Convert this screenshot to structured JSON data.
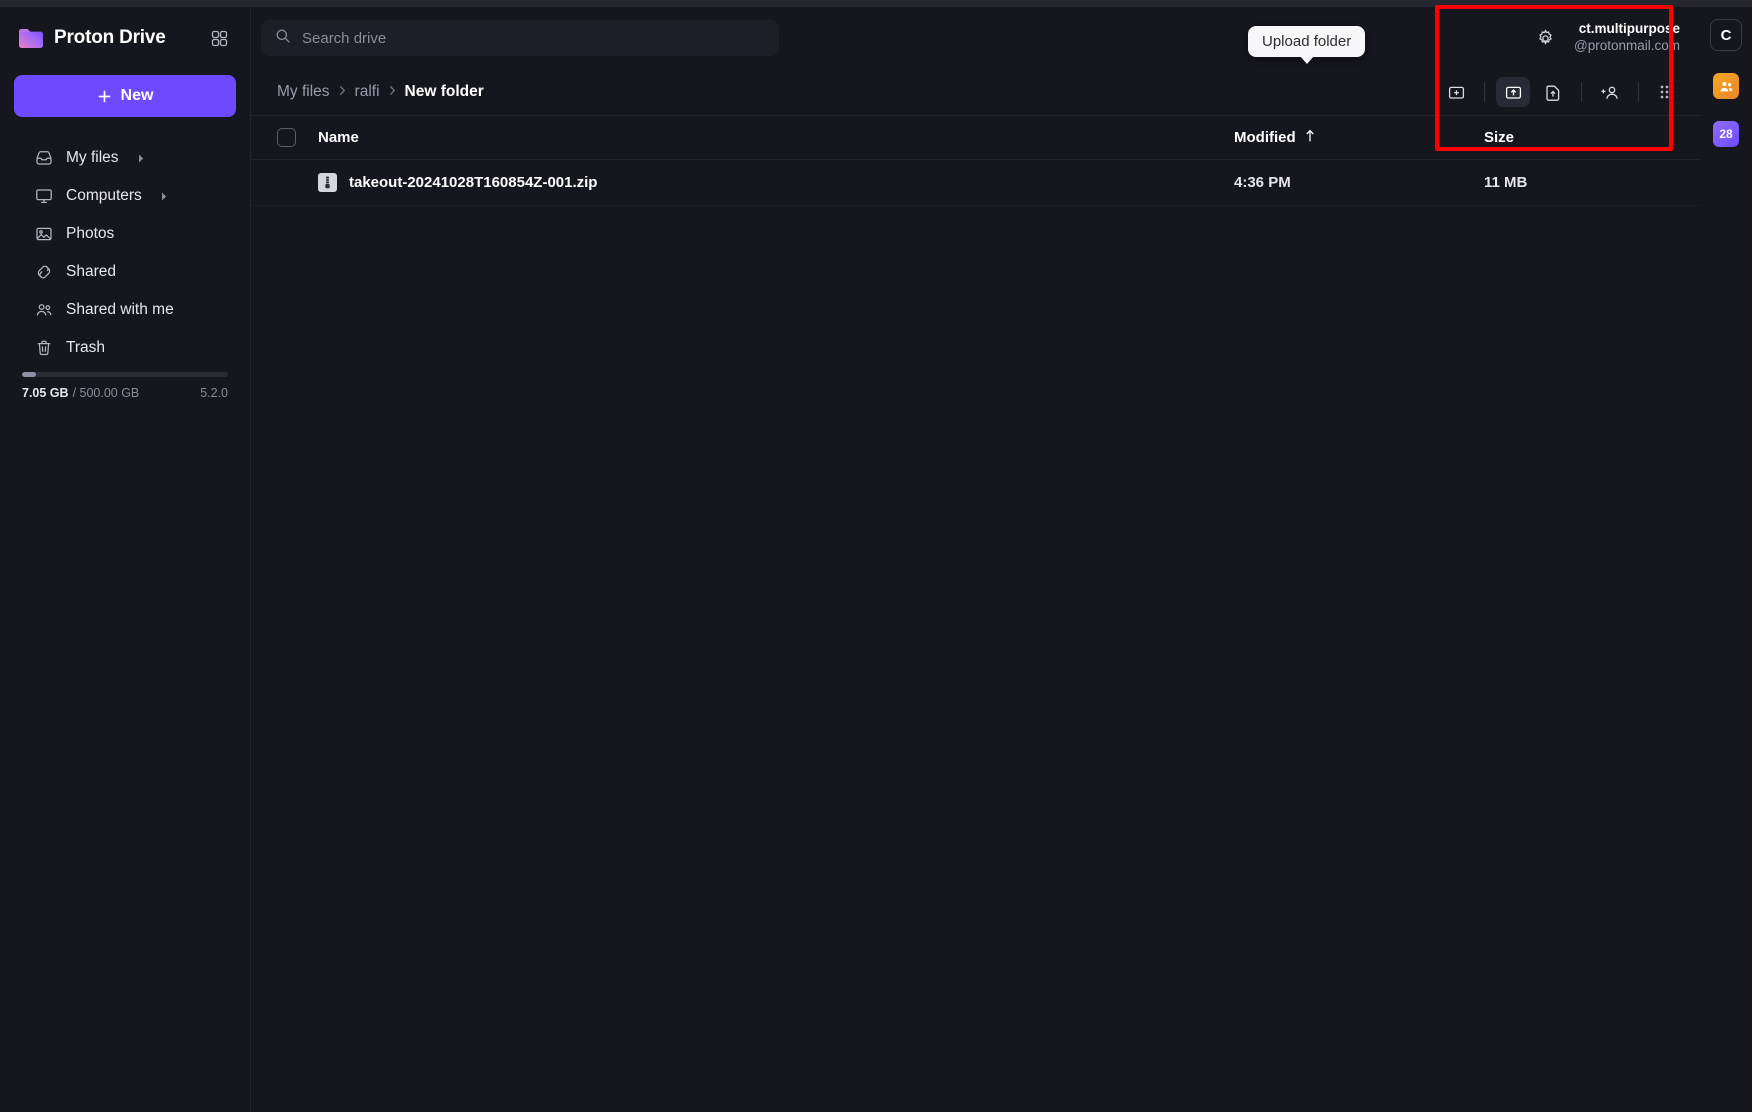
{
  "app": {
    "brand": "Proton Drive",
    "version": "5.2.0"
  },
  "sidebar": {
    "new_button": "New",
    "apps_grid_icon": "apps-grid-icon",
    "items": [
      {
        "label": "My files",
        "icon": "inbox-icon",
        "caret": true
      },
      {
        "label": "Computers",
        "icon": "monitor-icon",
        "caret": true
      },
      {
        "label": "Photos",
        "icon": "image-icon",
        "caret": false
      },
      {
        "label": "Shared",
        "icon": "link-icon",
        "caret": false
      },
      {
        "label": "Shared with me",
        "icon": "people-icon",
        "caret": false
      },
      {
        "label": "Trash",
        "icon": "trash-icon",
        "caret": false
      }
    ],
    "storage": {
      "used": "7.05 GB",
      "total": "/ 500.00 GB",
      "percent": 1.41
    }
  },
  "search": {
    "placeholder": "Search drive",
    "icon": "search-icon"
  },
  "header": {
    "settings_icon": "gear-icon",
    "account_name": "ct.multipurpose",
    "account_mail": "@protonmail.com",
    "avatar_initial": "C"
  },
  "tooltip": {
    "text": "Upload folder"
  },
  "breadcrumb": {
    "items": [
      "My files",
      "ralfi"
    ],
    "separator": "›",
    "current": "New folder"
  },
  "toolbar": {
    "buttons": [
      {
        "name": "new-folder-button",
        "icon": "folder-plus-icon",
        "active": false
      },
      {
        "name": "upload-folder-button",
        "icon": "folder-upload-icon",
        "active": true
      },
      {
        "name": "upload-file-button",
        "icon": "file-upload-icon",
        "active": false
      },
      {
        "name": "share-button",
        "icon": "person-add-icon",
        "active": false
      }
    ],
    "apps_icon": "apps-dots-icon"
  },
  "table": {
    "columns": {
      "name": "Name",
      "modified": "Modified",
      "size": "Size",
      "sort_icon": "arrow-up-icon"
    },
    "rows": [
      {
        "name": "takeout-20241028T160854Z-001.zip",
        "modified": "4:36 PM",
        "size": "11 MB",
        "icon": "zip-file-icon"
      }
    ]
  },
  "rail": {
    "apps": [
      {
        "name": "contacts-app-icon",
        "label": ""
      },
      {
        "name": "calendar-app-icon",
        "label": "28"
      }
    ]
  },
  "colors": {
    "accent": "#6d4aff",
    "background": "#16161e",
    "annotation": "#ff0000",
    "tooltip_bg": "#f7f7fa"
  }
}
